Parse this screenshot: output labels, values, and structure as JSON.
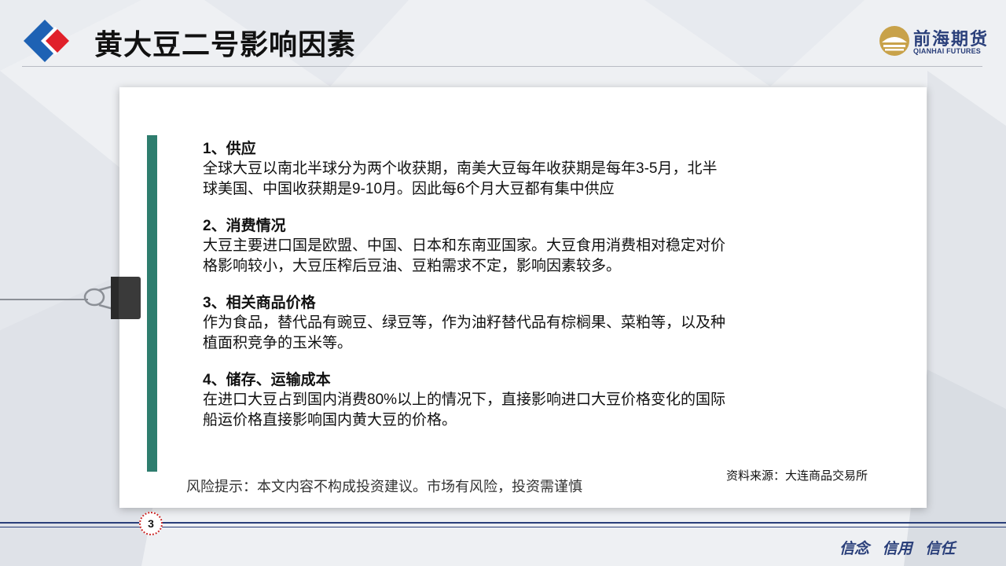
{
  "header": {
    "title": "黄大豆二号影响因素",
    "brand_cn": "前海期货",
    "brand_en": "QIANHAI FUTURES"
  },
  "items": [
    {
      "title": "1、供应",
      "lines": [
        "全球大豆以南北半球分为两个收获期，南美大豆每年收获期是每年3-5月，北半",
        "球美国、中国收获期是9-10月。因此每6个月大豆都有集中供应"
      ]
    },
    {
      "title": "2、消费情况",
      "lines": [
        "大豆主要进口国是欧盟、中国、日本和东南亚国家。大豆食用消费相对稳定对价",
        "格影响较小，大豆压榨后豆油、豆粕需求不定，影响因素较多。"
      ]
    },
    {
      "title": "3、相关商品价格",
      "lines": [
        "作为食品，替代品有豌豆、绿豆等，作为油籽替代品有棕榈果、菜粕等，以及种",
        "植面积竞争的玉米等。"
      ]
    },
    {
      "title": "4、储存、运输成本",
      "lines": [
        "在进口大豆占到国内消费80%以上的情况下，直接影响进口大豆价格变化的国际",
        "船运价格直接影响国内黄大豆的价格。"
      ]
    }
  ],
  "source": "资料来源：大连商品交易所",
  "risk_notice": "风险提示：本文内容不构成投资建议。市场有风险，投资需谨慎",
  "footer": {
    "page_number": "3",
    "motto": "信念 信用 信任"
  },
  "colors": {
    "accent_blue": "#1e62b4",
    "accent_red": "#e0202a",
    "bar_green": "#2e7d6e",
    "navy": "#2a3f7a"
  }
}
